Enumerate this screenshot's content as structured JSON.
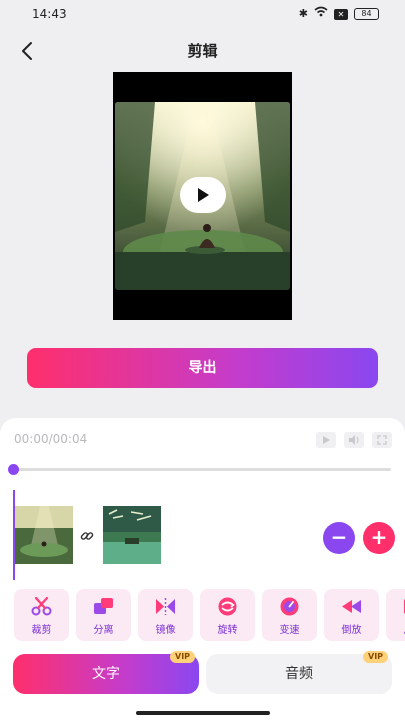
{
  "status_bar": {
    "time": "14:43",
    "battery": "84"
  },
  "header": {
    "title": "剪辑"
  },
  "export": {
    "label": "导出"
  },
  "player": {
    "time": "00:00/00:04",
    "progress": 0
  },
  "tools": [
    {
      "label": "裁剪",
      "icon": "scissors-icon"
    },
    {
      "label": "分离",
      "icon": "split-icon"
    },
    {
      "label": "镜像",
      "icon": "mirror-icon"
    },
    {
      "label": "旋转",
      "icon": "rotate-icon"
    },
    {
      "label": "变速",
      "icon": "speed-icon"
    },
    {
      "label": "倒放",
      "icon": "rewind-icon"
    },
    {
      "label": "片头",
      "icon": "intro-icon"
    }
  ],
  "tabs": {
    "text": "文字",
    "audio": "音频",
    "vip": "VIP"
  },
  "colors": {
    "accent_pink": "#ff2f6c",
    "accent_purple": "#8a47f0"
  }
}
